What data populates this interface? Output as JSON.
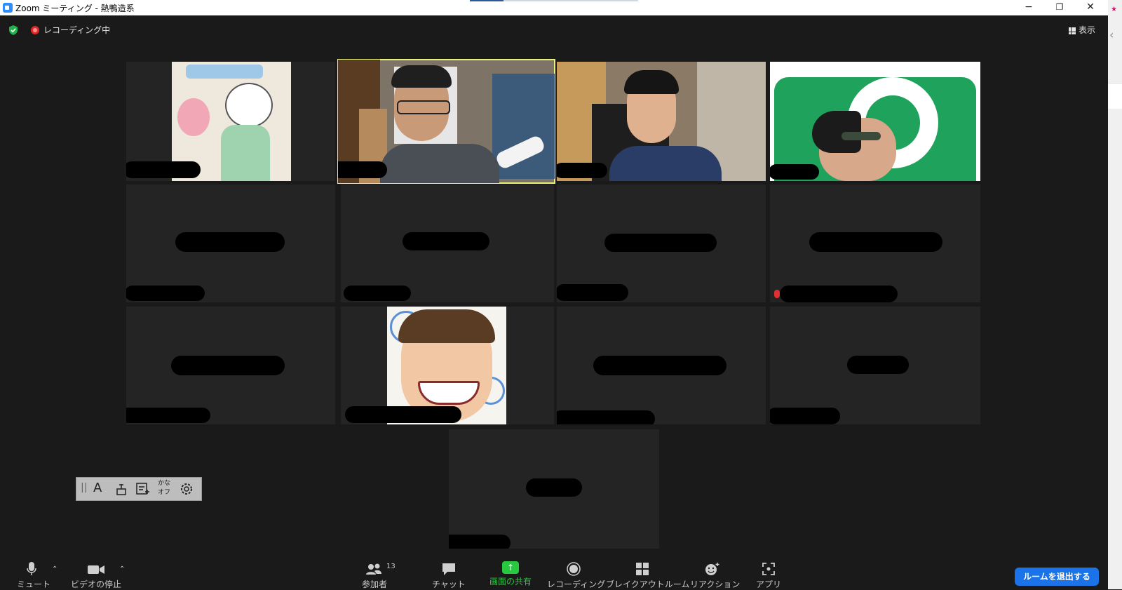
{
  "window": {
    "title": "Zoom ミーティング - 熱鴨造系",
    "buttons": {
      "minimize": "−",
      "restore": "❐",
      "close": "✕"
    }
  },
  "topbar": {
    "recording_label": "レコーディング中",
    "view_label": "表示"
  },
  "annotation_toolbar": {
    "handle": "||",
    "text_tool": "A",
    "kana_line1": "かな",
    "kana_line2": "オフ"
  },
  "toolbar": {
    "mute": {
      "label": "ミュート",
      "icon": "microphone-icon"
    },
    "video": {
      "label": "ビデオの停止",
      "icon": "video-camera-icon"
    },
    "participants": {
      "label": "参加者",
      "count": "13",
      "icon": "people-icon"
    },
    "chat": {
      "label": "チャット",
      "icon": "chat-bubble-icon"
    },
    "share": {
      "label": "画面の共有",
      "icon": "share-arrow-icon"
    },
    "record": {
      "label": "レコーディング",
      "icon": "record-icon"
    },
    "breakout": {
      "label": "ブレイクアウトルーム",
      "icon": "breakout-grid-icon"
    },
    "reactions": {
      "label": "リアクション",
      "icon": "smiley-icon"
    },
    "apps": {
      "label": "アプリ",
      "icon": "apps-icon"
    },
    "leave": "ルームを退出する"
  },
  "colors": {
    "background": "#1a1a1a",
    "tile": "#242424",
    "active_speaker_border": "#e6f07a",
    "share_green": "#27c93f",
    "leave_blue": "#1a73e8",
    "recording_red": "#e02828"
  }
}
